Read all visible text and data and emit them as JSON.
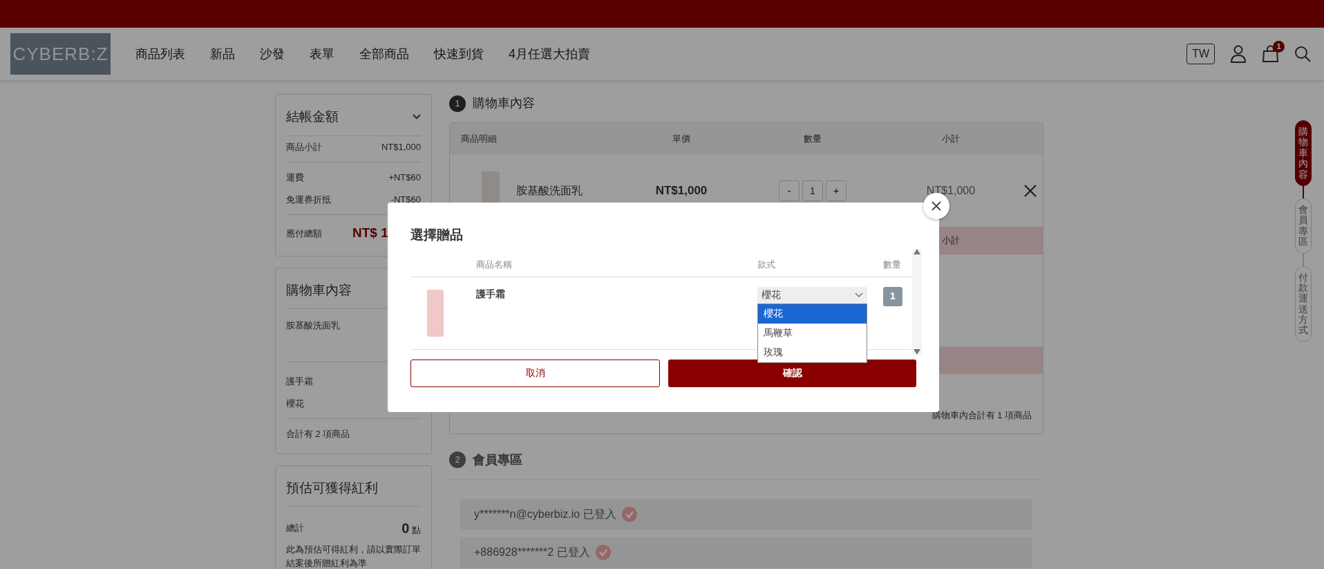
{
  "header": {
    "logo": "CYBERB:Z",
    "nav": [
      "商品列表",
      "新品",
      "沙發",
      "表單",
      "全部商品",
      "快速到貨",
      "4月任選大拍賣"
    ],
    "region": "TW",
    "cart_count": "1"
  },
  "summary": {
    "title": "結帳金額",
    "rows": [
      {
        "label": "商品小計",
        "value": "NT$1,000"
      },
      {
        "label": "運費",
        "value": "+NT$60"
      },
      {
        "label": "免運券折抵",
        "value": "-NT$60"
      }
    ],
    "total_label": "應付總額",
    "total_value": "NT$ 1"
  },
  "cart_summary": {
    "title": "購物車內容",
    "items": [
      {
        "name": "胺基酸洗面乳"
      },
      {
        "name": "護手霜",
        "variant": "櫻花"
      }
    ],
    "count_text": "合計有 2 項商品"
  },
  "rewards": {
    "title": "預估可獲得紅利",
    "label": "總計",
    "points": "0",
    "unit": "點",
    "note": "此為預估可得紅利，請以實際訂單結案後所贈紅利為準"
  },
  "cart": {
    "step": "1",
    "title": "購物車內容",
    "columns": [
      "商品明細",
      "單價",
      "數量",
      "小計"
    ],
    "items": [
      {
        "name": "胺基酸洗面乳",
        "price": "NT$1,000",
        "minus": "-",
        "quantity": "1",
        "plus": "+",
        "subtotal": "NT$1,000"
      }
    ],
    "gift_header": "小計",
    "footer": "購物車內合計有 1 項商品"
  },
  "member": {
    "step": "2",
    "title": "會員專區",
    "logins": [
      {
        "account": "y*******n@cyberbiz.io",
        "status": "已登入"
      },
      {
        "account": "+886928*******2",
        "status": "已登入"
      }
    ]
  },
  "side_steps": [
    {
      "label": "購物車內容",
      "selected": true
    },
    {
      "label": "會員專區",
      "selected": false
    },
    {
      "label": "付款運送方式",
      "selected": false
    }
  ],
  "modal": {
    "title": "選擇贈品",
    "columns": [
      "商品名稱",
      "款式",
      "數量"
    ],
    "gift": {
      "name": "護手霜",
      "variant": "櫻花",
      "quantity": "1"
    },
    "options": [
      {
        "label": "櫻花",
        "selected": true
      },
      {
        "label": "馬鞭草",
        "selected": false
      },
      {
        "label": "玫瑰",
        "selected": false
      }
    ],
    "cancel": "取消",
    "confirm": "確認"
  }
}
